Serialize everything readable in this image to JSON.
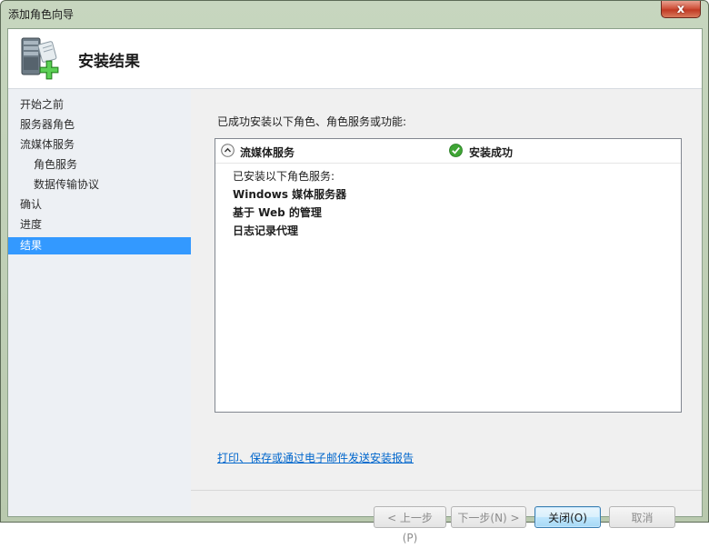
{
  "window": {
    "title": "添加角色向导",
    "close_glyph": "x"
  },
  "header": {
    "title": "安装结果",
    "icon": "server-add-icon"
  },
  "sidebar": {
    "items": [
      {
        "label": "开始之前",
        "indent": false,
        "active": false
      },
      {
        "label": "服务器角色",
        "indent": false,
        "active": false
      },
      {
        "label": "流媒体服务",
        "indent": false,
        "active": false
      },
      {
        "label": "角色服务",
        "indent": true,
        "active": false
      },
      {
        "label": "数据传输协议",
        "indent": true,
        "active": false
      },
      {
        "label": "确认",
        "indent": false,
        "active": false
      },
      {
        "label": "进度",
        "indent": false,
        "active": false
      },
      {
        "label": "结果",
        "indent": false,
        "active": true
      }
    ]
  },
  "main": {
    "intro": "已成功安装以下角色、角色服务或功能:",
    "result": {
      "role_name": "流媒体服务",
      "status": "安装成功",
      "installed_label": "已安装以下角色服务:",
      "services": [
        "Windows 媒体服务器",
        "基于 Web 的管理",
        "日志记录代理"
      ]
    },
    "report_link": "打印、保存或通过电子邮件发送安装报告"
  },
  "buttons": {
    "prev": "< 上一步(P)",
    "next": "下一步(N) >",
    "close": "关闭(O)",
    "cancel": "取消"
  },
  "colors": {
    "selected": "#3399ff",
    "link": "#0066cc",
    "success": "#3fa535"
  }
}
